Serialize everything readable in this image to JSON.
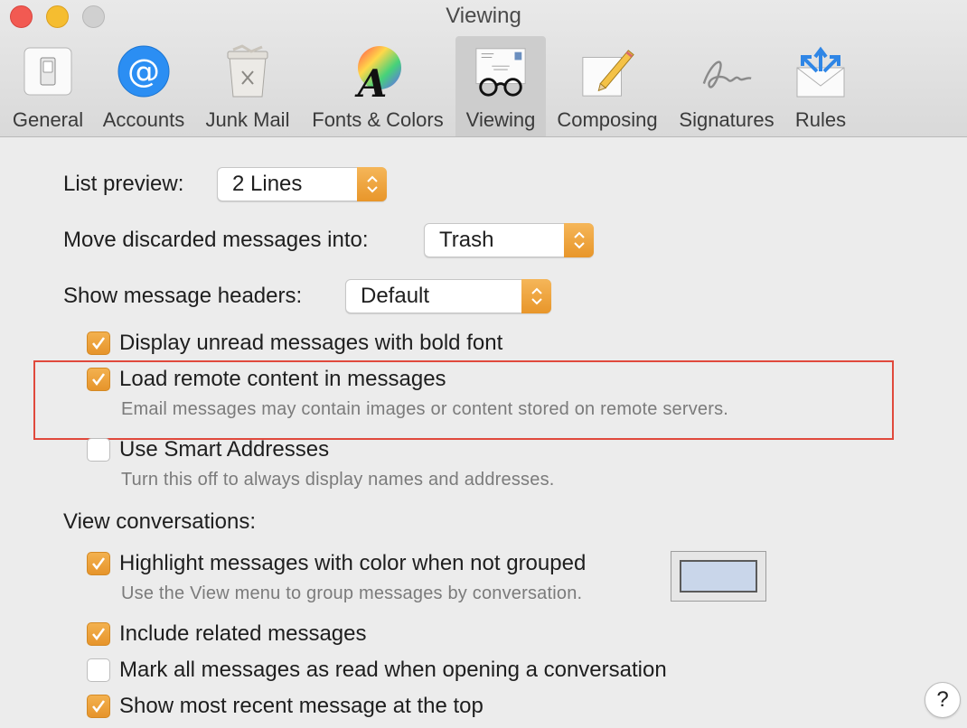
{
  "window": {
    "title": "Viewing"
  },
  "toolbar": {
    "tabs": [
      {
        "label": "General",
        "icon": "switch-icon"
      },
      {
        "label": "Accounts",
        "icon": "at-icon"
      },
      {
        "label": "Junk Mail",
        "icon": "trash-bin-icon"
      },
      {
        "label": "Fonts & Colors",
        "icon": "font-color-wheel-icon"
      },
      {
        "label": "Viewing",
        "icon": "glasses-letter-icon",
        "active": true
      },
      {
        "label": "Composing",
        "icon": "pencil-paper-icon"
      },
      {
        "label": "Signatures",
        "icon": "signature-icon"
      },
      {
        "label": "Rules",
        "icon": "rules-envelope-icon"
      }
    ],
    "font_icon_letter": "A"
  },
  "settings": {
    "list_preview": {
      "label": "List preview:",
      "value": "2 Lines"
    },
    "move_discarded": {
      "label": "Move discarded messages into:",
      "value": "Trash"
    },
    "message_headers": {
      "label": "Show message headers:",
      "value": "Default"
    },
    "bold_unread": {
      "label": "Display unread messages with bold font",
      "checked": true
    },
    "remote_content": {
      "label": "Load remote content in messages",
      "help": "Email messages may contain images or content stored on remote servers.",
      "checked": true
    },
    "smart_addresses": {
      "label": "Use Smart Addresses",
      "help": "Turn this off to always display names and addresses.",
      "checked": false
    },
    "view_conversations": {
      "label": "View conversations:"
    },
    "highlight_color": {
      "label": "Highlight messages with color when not grouped",
      "help": "Use the View menu to group messages by conversation.",
      "checked": true,
      "color": "#c9d6ea"
    },
    "related_messages": {
      "label": "Include related messages",
      "checked": true
    },
    "mark_read": {
      "label": "Mark all messages as read when opening a conversation",
      "checked": false
    },
    "recent_top": {
      "label": "Show most recent message at the top",
      "checked": true
    }
  },
  "help_button": {
    "label": "?"
  },
  "colors": {
    "accent": "#f0a53d",
    "annotation_box": "#e0493c",
    "close": "#f25a52",
    "minimize": "#f5bd30"
  }
}
